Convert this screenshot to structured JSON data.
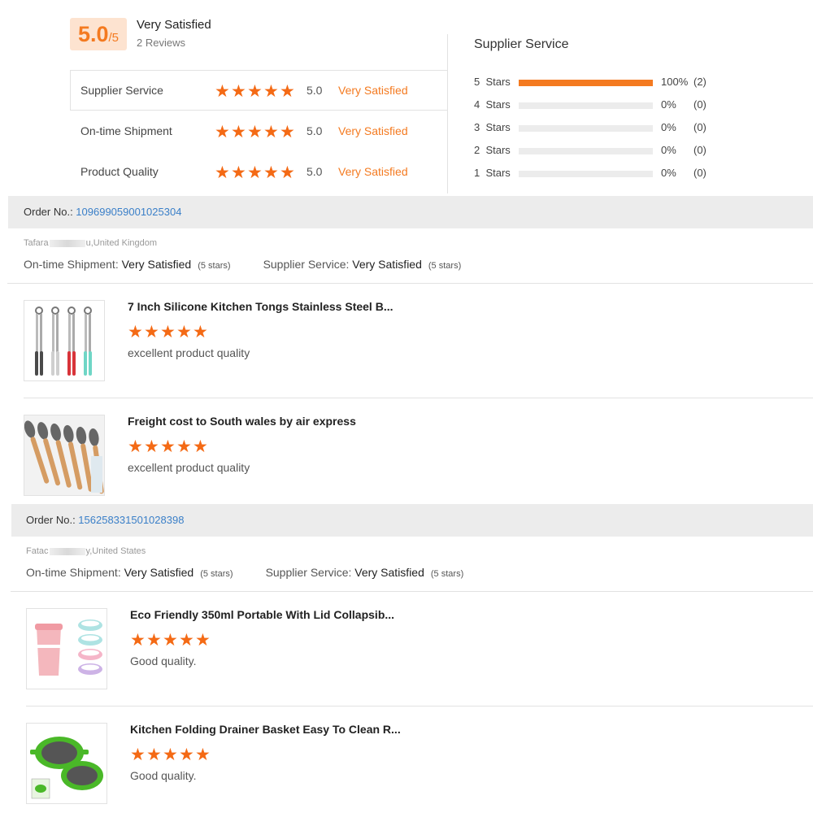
{
  "summary": {
    "score": "5.0",
    "score_suffix": "/5",
    "title": "Very Satisfied",
    "reviews": "2 Reviews"
  },
  "ratings": [
    {
      "label": "Supplier Service",
      "value": "5.0",
      "word": "Very Satisfied",
      "stars": 5
    },
    {
      "label": "On-time Shipment",
      "value": "5.0",
      "word": "Very Satisfied",
      "stars": 5
    },
    {
      "label": "Product Quality",
      "value": "5.0",
      "word": "Very Satisfied",
      "stars": 5
    }
  ],
  "distribution": {
    "title": "Supplier Service",
    "rows": [
      {
        "label": "5  Stars",
        "fraction": 1.0,
        "pct": "100%",
        "count": "(2)"
      },
      {
        "label": "4  Stars",
        "fraction": 0,
        "pct": "0%",
        "count": "(0)"
      },
      {
        "label": "3  Stars",
        "fraction": 0,
        "pct": "0%",
        "count": "(0)"
      },
      {
        "label": "2  Stars",
        "fraction": 0,
        "pct": "0%",
        "count": "(0)"
      },
      {
        "label": "1  Stars",
        "fraction": 0,
        "pct": "0%",
        "count": "(0)"
      }
    ]
  },
  "orders": [
    {
      "order_label": "Order No.: ",
      "order_no": "109699059001025304",
      "buyer_first": "Tafara",
      "buyer_last": "u,United Kingdom",
      "shipment_label": "On-time Shipment: ",
      "shipment_value": "Very Satisfied",
      "shipment_stars": "(5 stars)",
      "service_label": "Supplier Service: ",
      "service_value": "Very Satisfied",
      "service_stars": "(5 stars)",
      "products": [
        {
          "title": "7 Inch Silicone Kitchen Tongs Stainless Steel B...",
          "comment": "excellent product quality",
          "stars": 5,
          "image": "tongs"
        },
        {
          "title": "Freight cost to South wales by air express",
          "comment": "excellent product quality",
          "stars": 5,
          "image": "utensils"
        }
      ]
    },
    {
      "order_label": "Order No.: ",
      "order_no": "156258331501028398",
      "buyer_first": "Fatac",
      "buyer_last": "y,United States",
      "shipment_label": "On-time Shipment: ",
      "shipment_value": "Very Satisfied",
      "shipment_stars": "(5 stars)",
      "service_label": "Supplier Service: ",
      "service_value": "Very Satisfied",
      "service_stars": "(5 stars)",
      "products": [
        {
          "title": "Eco Friendly 350ml Portable With Lid Collapsib...",
          "comment": "Good quality.",
          "stars": 5,
          "image": "cups"
        },
        {
          "title": "Kitchen Folding Drainer Basket Easy To Clean R...",
          "comment": "Good quality.",
          "stars": 5,
          "image": "strainer"
        }
      ]
    }
  ],
  "colors": {
    "accent": "#f47a20",
    "star": "#f46a15",
    "link": "#3a7fc8"
  },
  "icons": {
    "star": "star-icon"
  }
}
